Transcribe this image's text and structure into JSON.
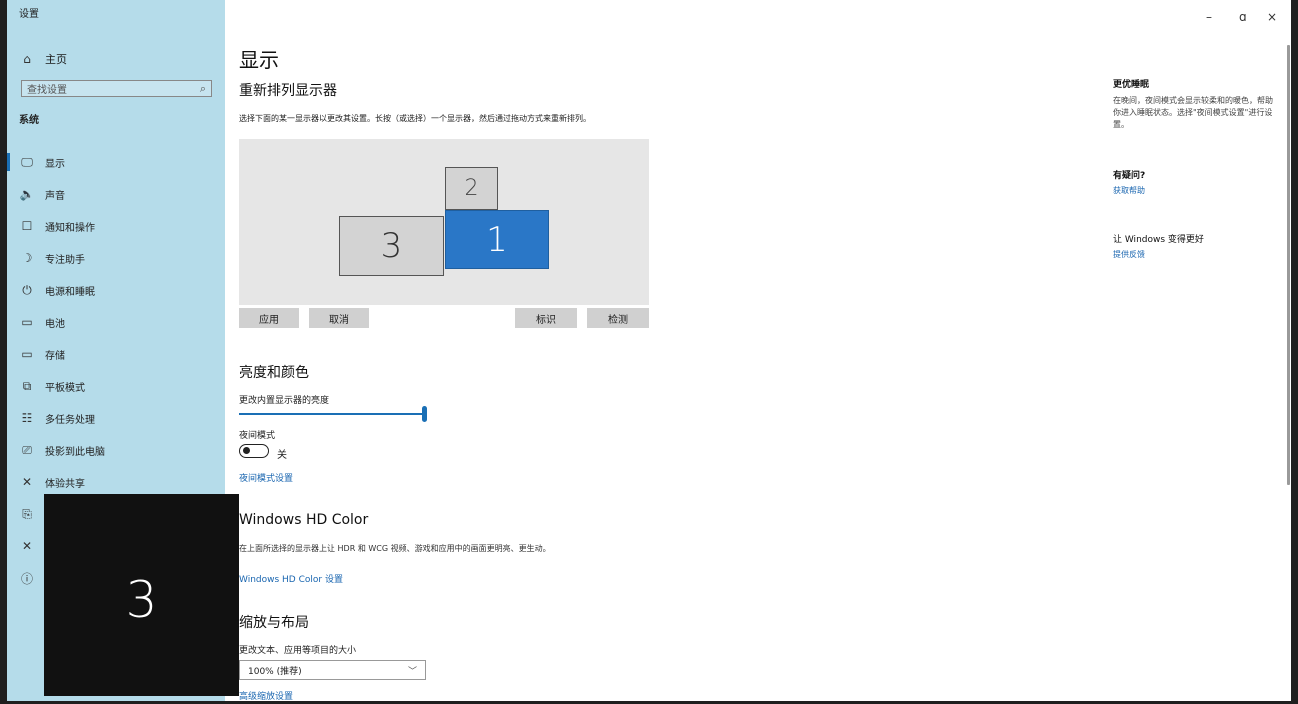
{
  "window": {
    "title": "设置",
    "controls": {
      "minimize": "–",
      "maximize": "ɑ",
      "close": "×"
    }
  },
  "sidebar": {
    "home": {
      "icon": "⌂",
      "label": "主页"
    },
    "search": {
      "placeholder": "查找设置",
      "icon": "⌕"
    },
    "section": "系统",
    "items": [
      {
        "icon": "🖵",
        "label": "显示",
        "active": true
      },
      {
        "icon": "🔈",
        "label": "声音"
      },
      {
        "icon": "☐",
        "label": "通知和操作"
      },
      {
        "icon": "☽",
        "label": "专注助手"
      },
      {
        "icon": "⏻",
        "label": "电源和睡眠"
      },
      {
        "icon": "▭",
        "label": "电池"
      },
      {
        "icon": "▭",
        "label": "存储"
      },
      {
        "icon": "⧉",
        "label": "平板模式"
      },
      {
        "icon": "☷",
        "label": "多任务处理"
      },
      {
        "icon": "⎚",
        "label": "投影到此电脑"
      },
      {
        "icon": "✕",
        "label": "体验共享"
      },
      {
        "icon": "⎘",
        "label": ""
      },
      {
        "icon": "✕",
        "label": ""
      },
      {
        "icon": "ⓘ",
        "label": ""
      }
    ]
  },
  "main": {
    "title": "显示",
    "arrange_title": "重新排列显示器",
    "arrange_desc": "选择下面的某一显示器以更改其设置。长按（或选择）一个显示器，然后通过拖动方式来重新排列。",
    "monitors": {
      "m1": "1",
      "m2": "2",
      "m3": "3"
    },
    "buttons": {
      "apply": "应用",
      "cancel": "取消",
      "identify": "标识",
      "detect": "检测"
    },
    "brightness": {
      "title": "亮度和颜色",
      "label": "更改内置显示器的亮度",
      "value_percent": 100,
      "night_label": "夜间模式",
      "night_state": "关",
      "night_link": "夜间模式设置"
    },
    "hdr": {
      "title": "Windows HD Color",
      "desc": "在上面所选择的显示器上让 HDR 和 WCG 视频、游戏和应用中的画面更明亮、更生动。",
      "link": "Windows HD Color 设置"
    },
    "scale": {
      "title": "缩放与布局",
      "label": "更改文本、应用等项目的大小",
      "value": "100% (推荐)",
      "advanced_link": "高级缩放设置"
    }
  },
  "right_panel": {
    "sleep_title": "更优睡眠",
    "sleep_text": "在晚间，夜间模式会显示较柔和的暖色，帮助你进入睡眠状态。选择\"夜间模式设置\"进行设置。",
    "help_title": "有疑问?",
    "help_link": "获取帮助",
    "feedback_title": "让 Windows 变得更好",
    "feedback_link": "提供反馈"
  },
  "identify_overlay": {
    "number": "3"
  }
}
